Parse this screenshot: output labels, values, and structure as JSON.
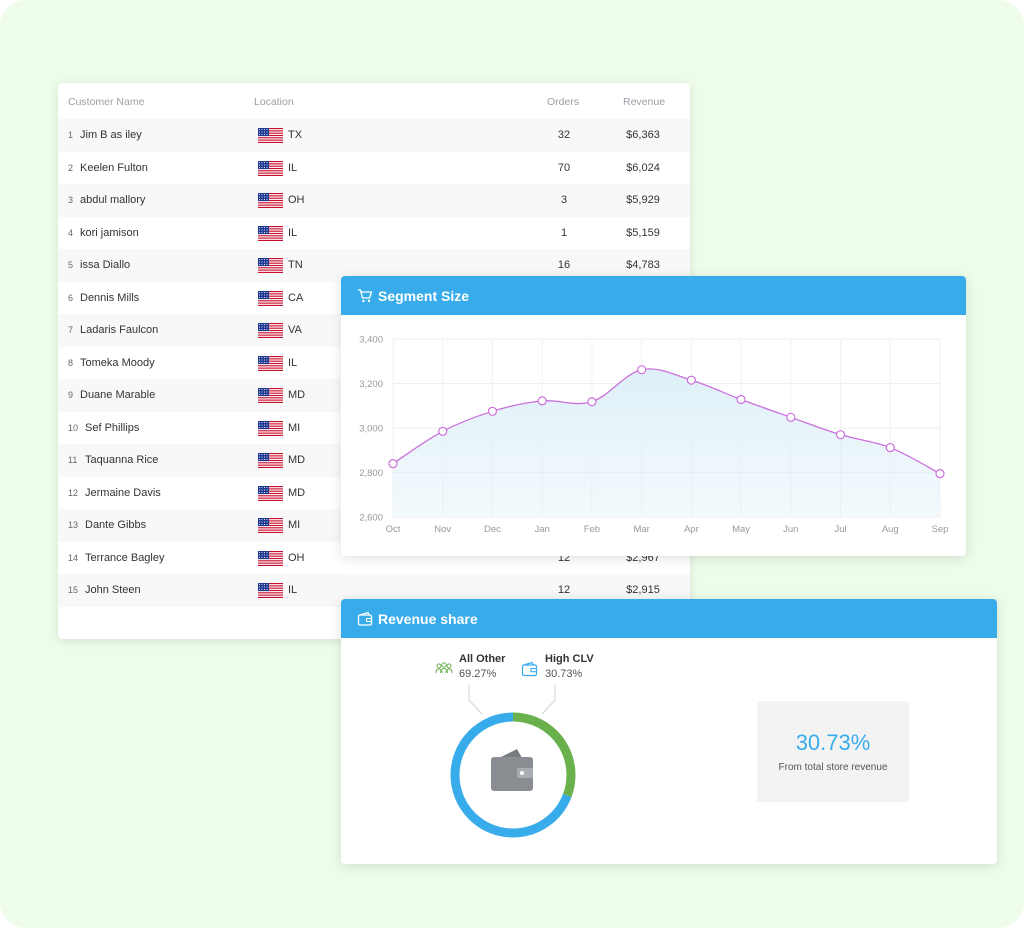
{
  "table": {
    "headers": {
      "name": "Customer Name",
      "location": "Location",
      "orders": "Orders",
      "revenue": "Revenue"
    },
    "rows": [
      {
        "idx": "1",
        "name": "Jim B as iley",
        "state": "TX",
        "orders": "32",
        "revenue": "$6,363"
      },
      {
        "idx": "2",
        "name": "Keelen Fulton",
        "state": "IL",
        "orders": "70",
        "revenue": "$6,024"
      },
      {
        "idx": "3",
        "name": "abdul mallory",
        "state": "OH",
        "orders": "3",
        "revenue": "$5,929"
      },
      {
        "idx": "4",
        "name": "kori jamison",
        "state": "IL",
        "orders": "1",
        "revenue": "$5,159"
      },
      {
        "idx": "5",
        "name": "issa Diallo",
        "state": "TN",
        "orders": "16",
        "revenue": "$4,783"
      },
      {
        "idx": "6",
        "name": "Dennis Mills",
        "state": "CA",
        "orders": "",
        "revenue": ""
      },
      {
        "idx": "7",
        "name": "Ladaris Faulcon",
        "state": "VA",
        "orders": "",
        "revenue": ""
      },
      {
        "idx": "8",
        "name": "Tomeka Moody",
        "state": "IL",
        "orders": "",
        "revenue": ""
      },
      {
        "idx": "9",
        "name": "Duane Marable",
        "state": "MD",
        "orders": "",
        "revenue": ""
      },
      {
        "idx": "10",
        "name": "Sef Phillips",
        "state": "MI",
        "orders": "",
        "revenue": ""
      },
      {
        "idx": "11",
        "name": "Taquanna Rice",
        "state": "MD",
        "orders": "",
        "revenue": ""
      },
      {
        "idx": "12",
        "name": "Jermaine Davis",
        "state": "MD",
        "orders": "",
        "revenue": ""
      },
      {
        "idx": "13",
        "name": "Dante Gibbs",
        "state": "MI",
        "orders": "",
        "revenue": ""
      },
      {
        "idx": "14",
        "name": "Terrance Bagley",
        "state": "OH",
        "orders": "12",
        "revenue": "$2,967"
      },
      {
        "idx": "15",
        "name": "John Steen",
        "state": "IL",
        "orders": "12",
        "revenue": "$2,915"
      }
    ]
  },
  "segment": {
    "title": "Segment Size",
    "icon": "cart-icon"
  },
  "chart_data": {
    "type": "area",
    "categories": [
      "Oct",
      "Nov",
      "Dec",
      "Jan",
      "Feb",
      "Mar",
      "Apr",
      "May",
      "Jun",
      "Jul",
      "Aug",
      "Sep"
    ],
    "values": [
      2840,
      2985,
      3075,
      3122,
      3118,
      3262,
      3215,
      3128,
      3048,
      2970,
      2912,
      2795
    ],
    "yticks": [
      "2,600",
      "2,800",
      "3,000",
      "3,200",
      "3,400"
    ],
    "ylim": [
      2600,
      3400
    ],
    "grid": true,
    "line_color": "#cc6fdd",
    "fill_color": "#dff0f8"
  },
  "revenue_share": {
    "title": "Revenue share",
    "icon": "wallet-icon",
    "legend": [
      {
        "name": "All Other",
        "pct": "69.27%",
        "icon": "people-icon",
        "color": "#38aceb"
      },
      {
        "name": "High CLV",
        "pct": "30.73%",
        "icon": "wallet-icon",
        "color": "#6ab04c"
      }
    ],
    "donut": {
      "high_clv_fraction": 0.3073,
      "all_other_fraction": 0.6927
    },
    "stat_value": "30.73%",
    "stat_label": "From total store revenue"
  },
  "colors": {
    "accent": "#38aceb",
    "green": "#6ab04c",
    "background": "#eefcea"
  }
}
